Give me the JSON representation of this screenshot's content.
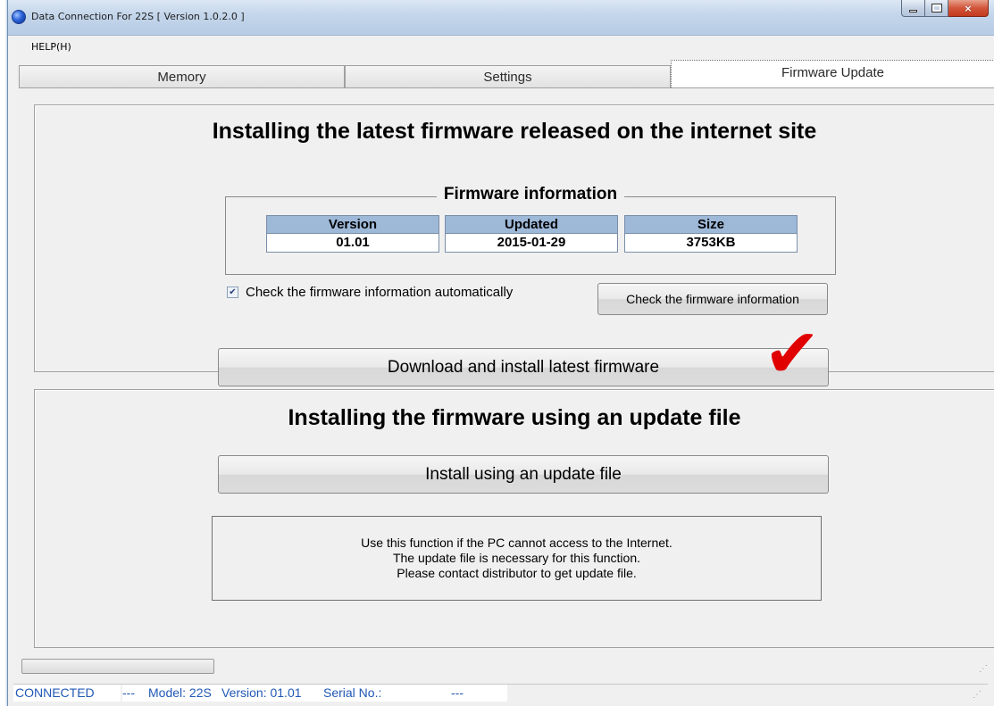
{
  "window": {
    "title": "Data Connection For 22S   [ Version 1.0.2.0 ]",
    "controls": {
      "minimize": "minimize-icon",
      "maximize": "maximize-icon",
      "close": "×"
    }
  },
  "menu": {
    "help": "HELP(H)"
  },
  "tabs": [
    {
      "label": "Memory",
      "active": false
    },
    {
      "label": "Settings",
      "active": false
    },
    {
      "label": "Firmware Update",
      "active": true
    }
  ],
  "online_section": {
    "heading": "Installing the latest firmware released on the internet site",
    "fw_info": {
      "title": "Firmware information",
      "columns": [
        {
          "header": "Version",
          "value": "01.01"
        },
        {
          "header": "Updated",
          "value": "2015-01-29"
        },
        {
          "header": "Size",
          "value": "3753KB"
        }
      ]
    },
    "auto_check": {
      "label": "Check the firmware information automatically",
      "checked": true
    },
    "check_button": "Check the firmware information",
    "download_button": "Download and install latest firmware",
    "annotation_mark": "✔"
  },
  "file_section": {
    "heading": "Installing the firmware using an update file",
    "install_button": "Install using an update file",
    "note_lines": [
      "Use this function if the PC cannot access to the Internet.",
      "The update file is necessary for this function.",
      "Please contact distributor to get update file."
    ]
  },
  "progress": {
    "value": 0
  },
  "status": {
    "connection": "CONNECTED",
    "separator": "---",
    "model": "Model: 22S",
    "version": "Version: 01.01",
    "serial": "Serial No.:",
    "serial_value": "---"
  },
  "colors": {
    "accent_blue": "#9eb8d8",
    "status_text": "#2058b5",
    "checkmark": "#e00000"
  }
}
